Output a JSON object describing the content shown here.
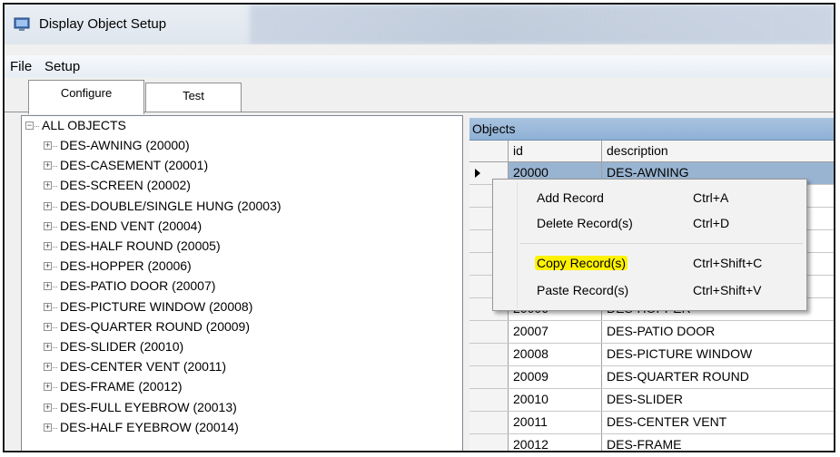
{
  "window": {
    "title": "Display Object Setup"
  },
  "menu": {
    "file": "File",
    "setup": "Setup"
  },
  "tabs": [
    {
      "label": "Configure",
      "active": true
    },
    {
      "label": "Test",
      "active": false
    }
  ],
  "tree": {
    "root": "ALL OBJECTS",
    "items": [
      "DES-AWNING (20000)",
      "DES-CASEMENT (20001)",
      "DES-SCREEN (20002)",
      "DES-DOUBLE/SINGLE HUNG (20003)",
      "DES-END VENT (20004)",
      "DES-HALF ROUND (20005)",
      "DES-HOPPER (20006)",
      "DES-PATIO DOOR (20007)",
      "DES-PICTURE WINDOW (20008)",
      "DES-QUARTER ROUND (20009)",
      "DES-SLIDER (20010)",
      "DES-CENTER VENT (20011)",
      "DES-FRAME (20012)",
      "DES-FULL EYEBROW (20013)",
      "DES-HALF EYEBROW (20014)"
    ]
  },
  "grid": {
    "caption": "Objects",
    "columns": {
      "id": "id",
      "description": "description"
    },
    "rows": [
      {
        "id": "20000",
        "description": "DES-AWNING"
      },
      {
        "id": "",
        "description": ""
      },
      {
        "id": "",
        "description": ""
      },
      {
        "id": "",
        "description": ""
      },
      {
        "id": "",
        "description": ""
      },
      {
        "id": "",
        "description": ""
      },
      {
        "id": "20006",
        "description": "DES-HOPPER"
      },
      {
        "id": "20007",
        "description": "DES-PATIO DOOR"
      },
      {
        "id": "20008",
        "description": "DES-PICTURE WINDOW"
      },
      {
        "id": "20009",
        "description": "DES-QUARTER ROUND"
      },
      {
        "id": "20010",
        "description": "DES-SLIDER"
      },
      {
        "id": "20011",
        "description": "DES-CENTER VENT"
      },
      {
        "id": "20012",
        "description": "DES-FRAME"
      }
    ]
  },
  "context_menu": [
    {
      "label": "Add Record",
      "shortcut": "Ctrl+A"
    },
    {
      "label": "Delete Record(s)",
      "shortcut": "Ctrl+D"
    },
    {
      "label": "Copy Record(s)",
      "shortcut": "Ctrl+Shift+C",
      "highlighted": true
    },
    {
      "label": "Paste Record(s)",
      "shortcut": "Ctrl+Shift+V"
    }
  ],
  "colors": {
    "selection": "#99b4d1",
    "highlight": "#fff200",
    "caption": "#9dbadb"
  },
  "icons": {
    "app": "display-window-icon",
    "expand": "plus-box-icon",
    "collapse": "minus-box-icon",
    "row_pointer": "row-pointer-icon"
  }
}
